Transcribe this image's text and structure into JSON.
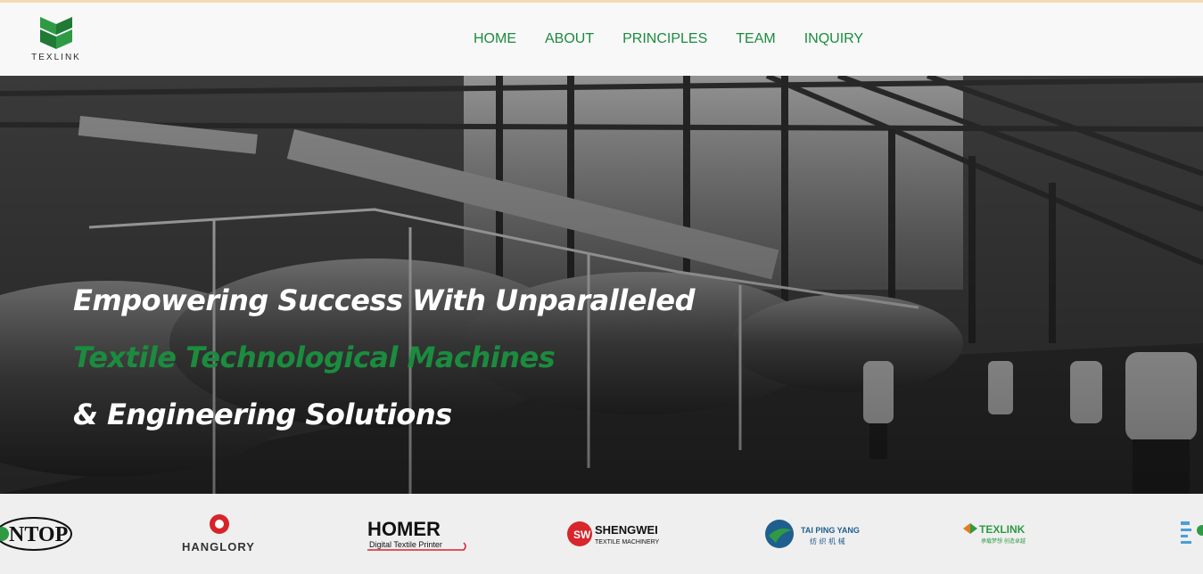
{
  "header": {
    "logo_text": "TEXLINK",
    "nav": [
      {
        "label": "HOME"
      },
      {
        "label": "ABOUT"
      },
      {
        "label": "PRINCIPLES"
      },
      {
        "label": "TEAM"
      },
      {
        "label": "INQUIRY"
      }
    ]
  },
  "hero": {
    "line1": "Empowering Success With Unparalleled",
    "line2": "Textile Technological Machines",
    "line3": "& Engineering Solutions"
  },
  "brands": {
    "items": [
      {
        "name": "NTOP"
      },
      {
        "name": "HANGLORY"
      },
      {
        "name": "HOMER",
        "sub": "Digital Textile Printer"
      },
      {
        "name": "SHENGWEI",
        "sub": "TEXTILE MACHINERY"
      },
      {
        "name": "TAI PING YANG",
        "sub": "纺 织 机 械"
      },
      {
        "name": "TEXLINK",
        "sub": "承载梦想 创造卓越"
      }
    ]
  },
  "colors": {
    "brand_green": "#1b8c3e",
    "hero_text": "#ffffff",
    "homer_red": "#d6242a",
    "shengwei_red": "#d8262b",
    "taiping_blue": "#1f5f8f"
  }
}
